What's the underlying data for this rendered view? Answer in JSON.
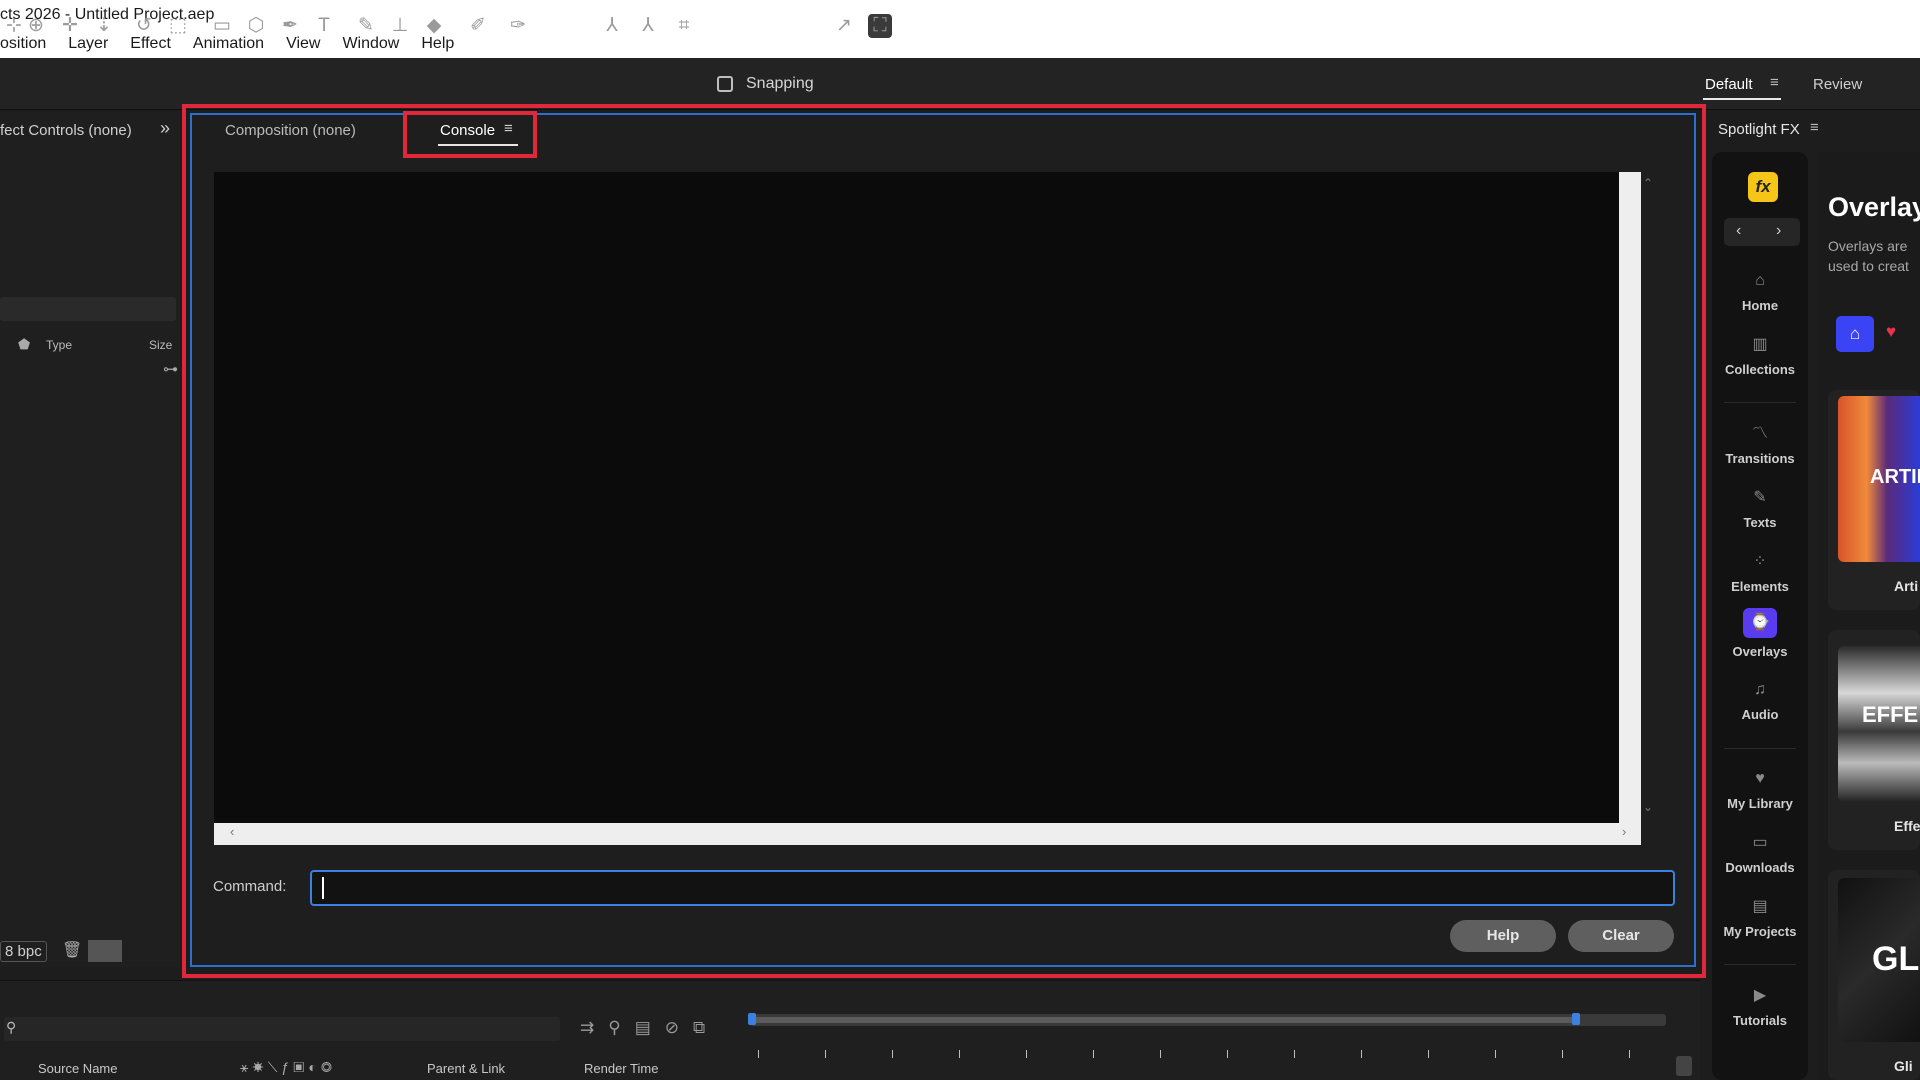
{
  "window": {
    "title": "cts 2026 - Untitled Project.aep"
  },
  "menu": [
    "osition",
    "Layer",
    "Effect",
    "Animation",
    "View",
    "Window",
    "Help"
  ],
  "toolbar": {
    "snapping_label": "Snapping",
    "snapping_checked": false,
    "workspace_default": "Default",
    "workspace_review": "Review"
  },
  "left_panel": {
    "title": "fect Controls (none)",
    "columns": {
      "type": "Type",
      "size": "Size"
    },
    "bpc": "8 bpc"
  },
  "center": {
    "tabs": [
      {
        "label": "Composition (none)",
        "active": false
      },
      {
        "label": "Console",
        "active": true
      }
    ],
    "command_label": "Command:",
    "command_value": "",
    "help_button": "Help",
    "clear_button": "Clear"
  },
  "timeline": {
    "columns": {
      "source_name": "Source Name",
      "parent_link": "Parent & Link",
      "render_time": "Render Time"
    }
  },
  "spotlight": {
    "header": "Spotlight FX",
    "logo": "fx",
    "nav": [
      {
        "label": "Home",
        "icon": "home-icon"
      },
      {
        "label": "Collections",
        "icon": "collections-icon"
      },
      {
        "label": "Transitions",
        "icon": "transitions-icon"
      },
      {
        "label": "Texts",
        "icon": "pen-icon"
      },
      {
        "label": "Elements",
        "icon": "grid-icon"
      },
      {
        "label": "Overlays",
        "icon": "overlays-icon",
        "active": true
      },
      {
        "label": "Audio",
        "icon": "music-icon"
      },
      {
        "label": "My Library",
        "icon": "heart-icon"
      },
      {
        "label": "Downloads",
        "icon": "download-icon"
      },
      {
        "label": "My Projects",
        "icon": "folder-icon"
      },
      {
        "label": "Tutorials",
        "icon": "play-icon"
      }
    ],
    "content_title": "Overlay",
    "content_desc_line1": "Overlays are",
    "content_desc_line2": "used to creat",
    "cards": [
      {
        "thumb_text": "ARTIF",
        "name": "Arti"
      },
      {
        "thumb_text": "EFFE",
        "name": "Effe"
      },
      {
        "thumb_text": "GLI",
        "name": "Gli"
      }
    ]
  },
  "colors": {
    "accent_blue": "#3b82e0",
    "highlight_red": "#e0283a",
    "fx_yellow": "#f5c518",
    "overlay_purple": "#5a3cf0",
    "home_blue": "#3b44f5"
  }
}
